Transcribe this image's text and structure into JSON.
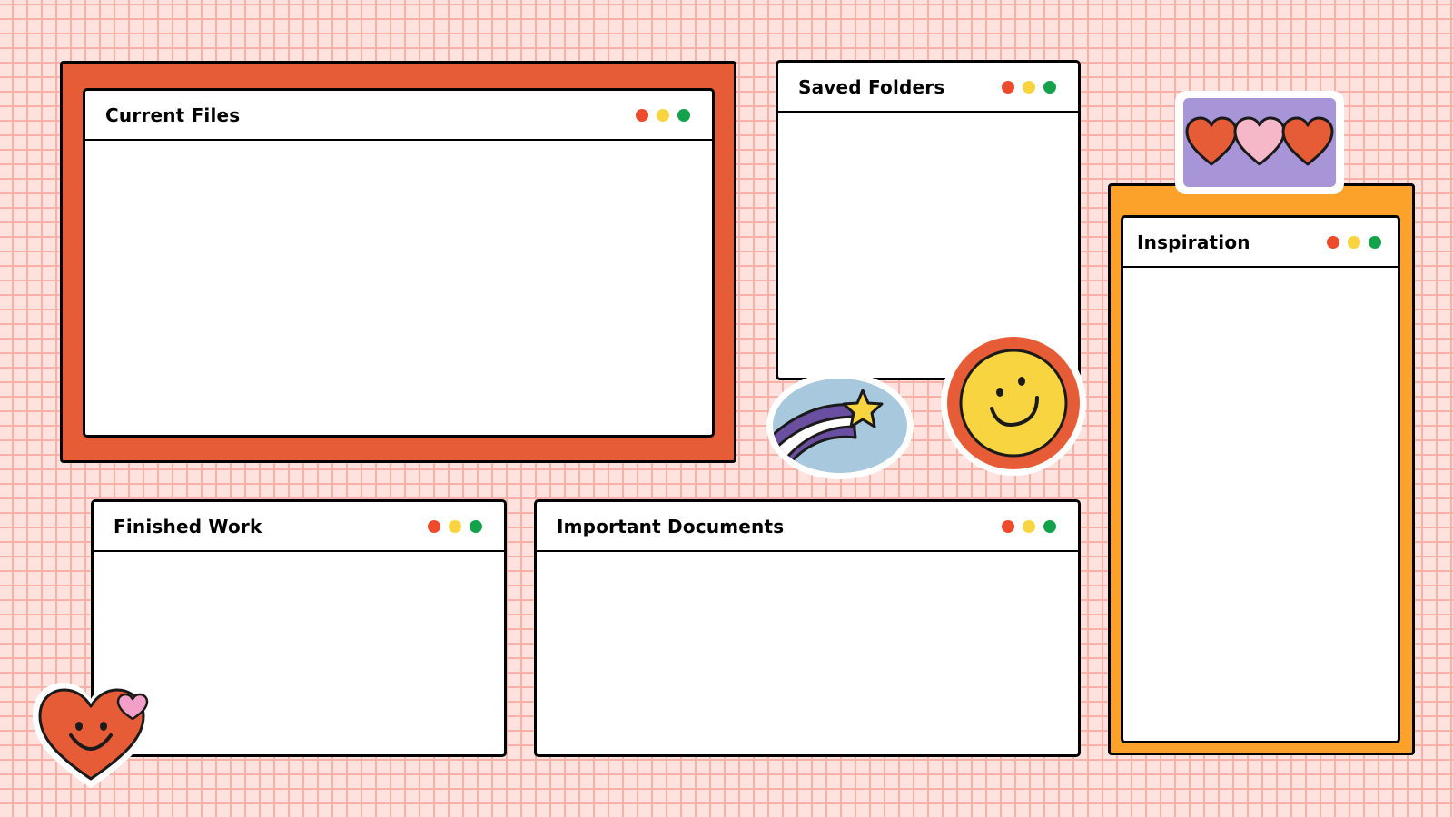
{
  "colors": {
    "background": "#ffe2de",
    "grid_line": "#f6b1a8",
    "frame_red": "#e55c36",
    "frame_orange": "#fca22b",
    "hearts_panel": "#a795d8",
    "dot_red": "#ee4a2c",
    "dot_yellow": "#f8d440",
    "dot_green": "#13a24a"
  },
  "windows": {
    "current_files": {
      "title": "Current Files"
    },
    "saved_folders": {
      "title": "Saved Folders"
    },
    "inspiration": {
      "title": "Inspiration"
    },
    "finished_work": {
      "title": "Finished Work"
    },
    "important_documents": {
      "title": "Important Documents"
    }
  },
  "window_controls": [
    "close-dot",
    "minimize-dot",
    "maximize-dot"
  ],
  "stickers": [
    "shooting-star-sticker",
    "smiley-face-sticker",
    "three-hearts-sticker",
    "heart-smiley-sticker"
  ]
}
